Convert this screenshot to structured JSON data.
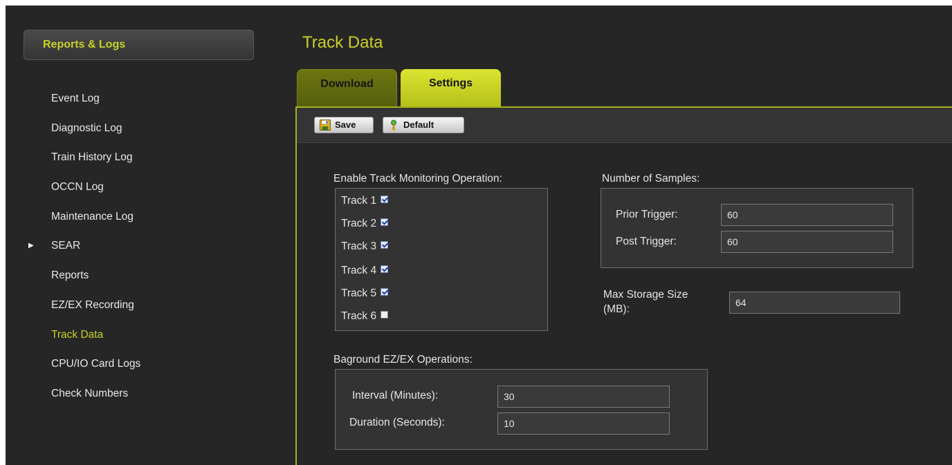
{
  "sidebar": {
    "header": "Reports & Logs",
    "items": [
      {
        "label": "Event Log"
      },
      {
        "label": "Diagnostic Log"
      },
      {
        "label": "Train History Log"
      },
      {
        "label": "OCCN Log"
      },
      {
        "label": "Maintenance Log"
      },
      {
        "label": "SEAR",
        "arrow": "▶"
      },
      {
        "label": "Reports"
      },
      {
        "label": "EZ/EX Recording"
      },
      {
        "label": "Track Data",
        "active": true
      },
      {
        "label": "CPU/IO Card Logs"
      },
      {
        "label": "Check Numbers"
      }
    ]
  },
  "page": {
    "title": "Track Data",
    "tabs": [
      {
        "label": "Download"
      },
      {
        "label": "Settings",
        "selected": true
      }
    ]
  },
  "toolbar": {
    "save_label": "Save",
    "default_label": "Default",
    "save_icon": "floppy-disk-icon",
    "default_icon": "green-pin-icon"
  },
  "tracks": {
    "label": "Enable Track Monitoring Operation:",
    "items": [
      {
        "label": "Track 1",
        "checked": true
      },
      {
        "label": "Track 2",
        "checked": true
      },
      {
        "label": "Track 3",
        "checked": true
      },
      {
        "label": "Track 4",
        "checked": true
      },
      {
        "label": "Track 5",
        "checked": true
      },
      {
        "label": "Track 6",
        "checked": false
      }
    ]
  },
  "samples": {
    "label": "Number of Samples:",
    "prior_label": "Prior Trigger:",
    "prior_value": "60",
    "post_label": "Post Trigger:",
    "post_value": "60"
  },
  "storage": {
    "label_line1": "Max Storage Size",
    "label_line2": "(MB):",
    "value": "64"
  },
  "background_ops": {
    "label": "Baground EZ/EX Operations:",
    "interval_label": "Interval (Minutes):",
    "interval_value": "30",
    "duration_label": "Duration (Seconds):",
    "duration_value": "10"
  },
  "colors": {
    "accent": "#c9d128",
    "background": "#262626",
    "tab_selected": "#d4dd2c"
  }
}
